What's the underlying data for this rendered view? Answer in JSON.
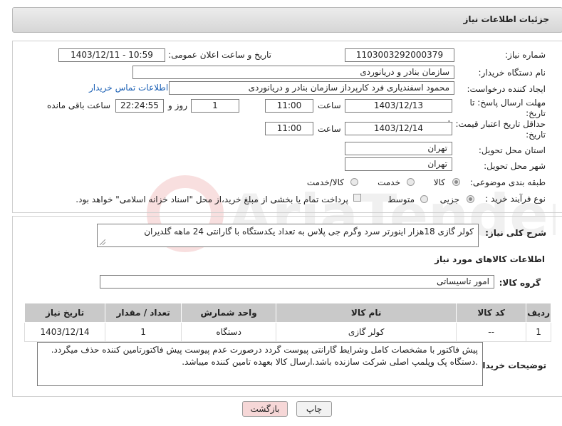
{
  "header": {
    "title": "جزئیات اطلاعات نیاز"
  },
  "form": {
    "need_number_label": "شماره نیاز:",
    "need_number": "1103003292000379",
    "announce_label": "تاریخ و ساعت اعلان عمومی:",
    "announce_value": "1403/12/11 - 10:59",
    "buyer_org_label": "نام دستگاه خریدار:",
    "buyer_org": "سازمان بنادر و دریانوردی",
    "creator_label": "ایجاد کننده درخواست:",
    "creator": "محمود اسفندیاری فرد کارپرداز سازمان بنادر و دریانوردی",
    "contact_link": "اطلاعات تماس خریدار",
    "deadline_label_1": "مهلت ارسال پاسخ: تا",
    "deadline_label_2": "تاریخ:",
    "deadline_date": "1403/12/13",
    "time_label": "ساعت",
    "deadline_time": "11:00",
    "days_value": "1",
    "days_label": "روز و",
    "remaining_time": "22:24:55",
    "remaining_label": "ساعت باقی مانده",
    "validity_label_1": "حداقل تاریخ اعتبار قیمت: تا",
    "validity_label_2": "تاریخ:",
    "validity_date": "1403/12/14",
    "validity_time_label": "ساعت",
    "validity_time": "11:00",
    "province_label": "استان محل تحویل:",
    "province": "تهران",
    "city_label": "شهر محل تحویل:",
    "city": "تهران",
    "category_label": "طبقه بندی موضوعی:",
    "category_options": [
      "کالا",
      "خدمت",
      "کالا/خدمت"
    ],
    "purchase_type_label": "نوع فرآیند خرید :",
    "purchase_options": [
      "جزیی",
      "متوسط"
    ],
    "payment_note": "پرداخت تمام یا بخشی از مبلغ خرید،از محل \"اسناد خزانه اسلامی\" خواهد بود."
  },
  "details": {
    "description_label": "شرح کلی نیاز:",
    "description": "کولر گازی 18هزار اینورتر سرد وگرم جی پلاس به تعداد یکدستگاه با گارانتی 24 ماهه گلدیران",
    "goods_info_title": "اطلاعات کالاهای مورد نیاز",
    "goods_group_label": "گروه کالا:",
    "goods_group": "امور تاسیساتی"
  },
  "table": {
    "headers": [
      "ردیف",
      "کد کالا",
      "نام کالا",
      "واحد شمارش",
      "تعداد / مقدار",
      "تاریخ نیاز"
    ],
    "rows": [
      [
        "1",
        "--",
        "کولر گازی",
        "دستگاه",
        "1",
        "1403/12/14"
      ]
    ]
  },
  "buyer_notes": {
    "label": "توضیحات خریدار:",
    "line1": "پیش فاکتور با مشخصات کامل وشرایط گارانتی پیوست گردد درصورت عدم پیوست پیش فاکتورتامین کننده حذف میگردد.",
    "line2": ".دستگاه پک وپلمپ اصلی شرکت سازنده باشد.ارسال کالا بعهده تامین کننده میباشد."
  },
  "buttons": {
    "print": "چاپ",
    "back": "بازگشت"
  },
  "watermark": "AriaTender.net",
  "colors": {
    "link": "#1a5fb4",
    "header_bg": "#dcdcdc",
    "back_btn": "#f6d7d7"
  }
}
